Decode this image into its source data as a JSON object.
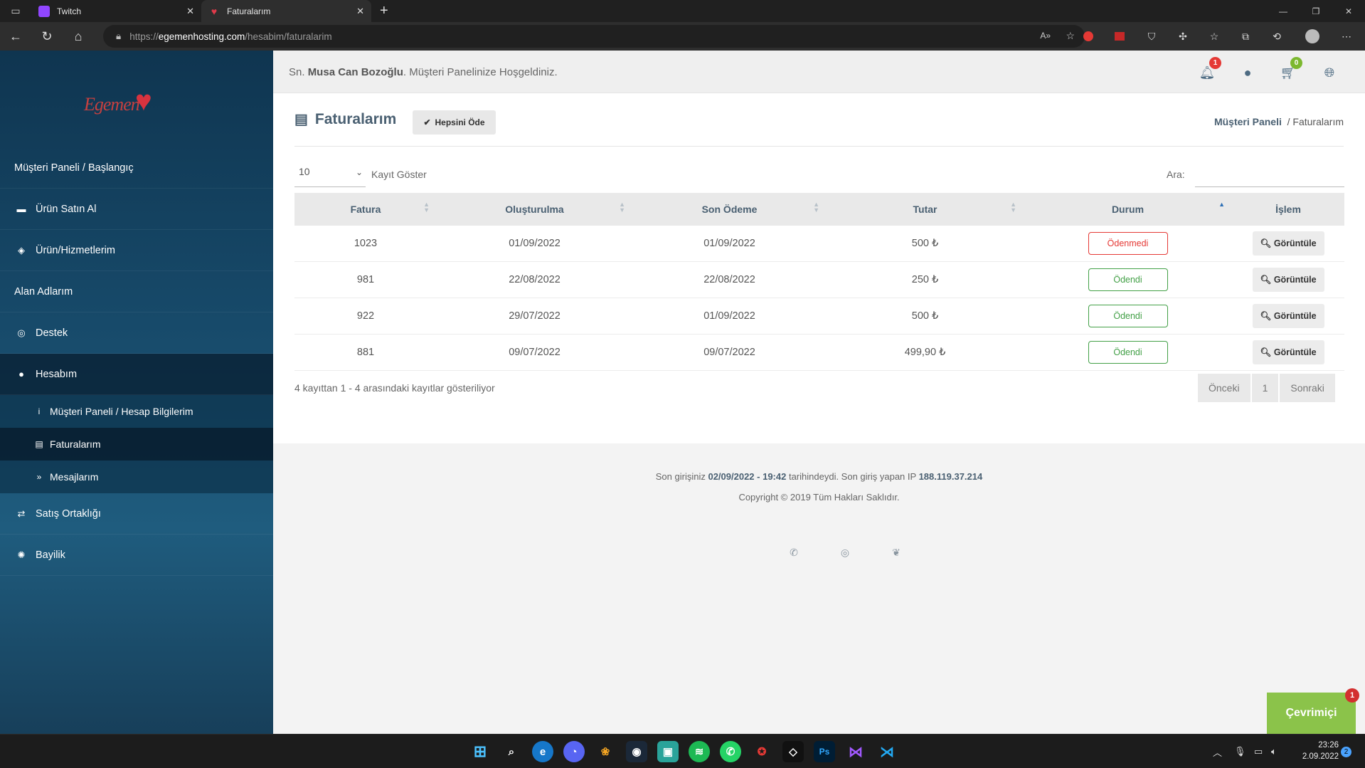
{
  "browser": {
    "tabs": [
      {
        "title": "Twitch",
        "active": false
      },
      {
        "title": "Faturalarım",
        "active": true
      }
    ],
    "address": {
      "proto": "https://",
      "host": "egemenhosting.com",
      "path": "/hesabim/faturalarim"
    },
    "extension_badge": "1"
  },
  "sidebar": {
    "logo_text": "Egemen",
    "items": [
      {
        "label": "Müşteri Paneli / Başlangıç",
        "icon": ""
      },
      {
        "label": "Ürün Satın Al",
        "icon": "credit-card-icon"
      },
      {
        "label": "Ürün/Hizmetlerim",
        "icon": "cube-icon"
      },
      {
        "label": "Alan Adlarım",
        "icon": ""
      },
      {
        "label": "Destek",
        "icon": "life-ring-icon"
      },
      {
        "label": "Hesabım",
        "icon": "user-icon"
      },
      {
        "label": "Satış Ortaklığı",
        "icon": "handshake-icon"
      },
      {
        "label": "Bayilik",
        "icon": "certificate-icon"
      }
    ],
    "subitems": [
      {
        "label": "Müşteri Paneli / Hesap Bilgilerim",
        "icon": "info-icon"
      },
      {
        "label": "Faturalarım",
        "icon": "file-icon"
      },
      {
        "label": "Mesajlarım",
        "icon": "double-chevron-icon"
      }
    ]
  },
  "topbar": {
    "prefix": "Sn.",
    "user_name": "Musa Can Bozoğlu",
    "welcome_suffix": ". Müşteri Panelinize Hoşgeldiniz.",
    "notification_count": "1",
    "cart_count": "0"
  },
  "page": {
    "title": "Faturalarım",
    "pay_all_label": "Hepsini Öde",
    "breadcrumb_root": "Müşteri Paneli",
    "breadcrumb_current": "/ Faturalarım",
    "page_length": "10",
    "page_length_label": "Kayıt Göster",
    "search_label": "Ara:",
    "search_value": ""
  },
  "table": {
    "headers": [
      "Fatura",
      "Oluşturulma",
      "Son Ödeme",
      "Tutar",
      "Durum",
      "İşlem"
    ],
    "rows": [
      {
        "id": "1023",
        "created": "01/09/2022",
        "due": "01/09/2022",
        "amount": "500 ₺",
        "status": "Ödenmedi",
        "status_type": "unpaid",
        "action": "Görüntüle"
      },
      {
        "id": "981",
        "created": "22/08/2022",
        "due": "22/08/2022",
        "amount": "250 ₺",
        "status": "Ödendi",
        "status_type": "paid",
        "action": "Görüntüle"
      },
      {
        "id": "922",
        "created": "29/07/2022",
        "due": "01/09/2022",
        "amount": "500 ₺",
        "status": "Ödendi",
        "status_type": "paid",
        "action": "Görüntüle"
      },
      {
        "id": "881",
        "created": "09/07/2022",
        "due": "09/07/2022",
        "amount": "499,90 ₺",
        "status": "Ödendi",
        "status_type": "paid",
        "action": "Görüntüle"
      }
    ],
    "info": "4 kayıttan 1 - 4 arasındaki kayıtlar gösteriliyor",
    "pagination": {
      "prev": "Önceki",
      "page": "1",
      "next": "Sonraki"
    }
  },
  "footer": {
    "last_login_prefix": "Son girişiniz",
    "last_login_time": "02/09/2022 - 19:42",
    "last_login_mid": "tarihindeydi. Son giriş yapan IP",
    "last_login_ip": "188.119.37.214",
    "copyright": "Copyright © 2019 Tüm Hakları Saklıdır."
  },
  "chat": {
    "label": "Çevrimiçi",
    "badge": "1"
  },
  "taskbar": {
    "time": "23:26",
    "date": "2.09.2022",
    "notification_count": "2"
  },
  "colors": {
    "sidebar": "#174a6a",
    "accent": "#4a6072",
    "unpaid": "#e53935",
    "paid": "#43a047",
    "chat": "#8bc34a"
  }
}
